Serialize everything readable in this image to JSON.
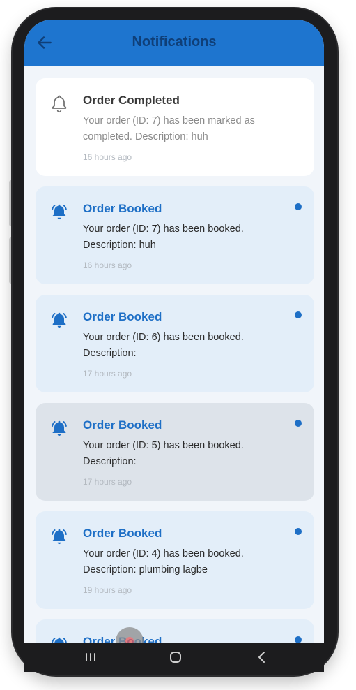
{
  "appbar": {
    "title": "Notifications",
    "back_icon": "arrow-left-icon"
  },
  "colors": {
    "appbar": "#1e75cf",
    "title": "#0f3f78",
    "unread_card": "#e3eef9",
    "read_card": "#ffffff",
    "accent": "#1e6fc6"
  },
  "notifications": [
    {
      "title": "Order Completed",
      "body": "Your order (ID: 7) has been marked as completed. Description: huh",
      "time": "16 hours ago",
      "state": "read",
      "icon": "bell-outline-icon"
    },
    {
      "title": "Order Booked",
      "body": "Your order (ID: 7) has been booked. Description: huh",
      "time": "16 hours ago",
      "state": "unread",
      "icon": "bell-ringing-icon"
    },
    {
      "title": "Order Booked",
      "body": "Your order (ID: 6) has been booked. Description:",
      "time": "17 hours ago",
      "state": "unread",
      "icon": "bell-ringing-icon"
    },
    {
      "title": "Order Booked",
      "body": "Your order (ID: 5) has been booked. Description:",
      "time": "17 hours ago",
      "state": "pressed",
      "icon": "bell-ringing-icon"
    },
    {
      "title": "Order Booked",
      "body": "Your order (ID: 4) has been booked. Description: plumbing lagbe",
      "time": "19 hours ago",
      "state": "unread",
      "icon": "bell-ringing-icon"
    },
    {
      "title": "Order Booked",
      "body": "",
      "time": "",
      "state": "unread",
      "icon": "bell-ringing-icon"
    }
  ],
  "system_nav": {
    "recents_icon": "recents-icon",
    "home_icon": "home-icon",
    "back_icon": "system-back-icon"
  }
}
